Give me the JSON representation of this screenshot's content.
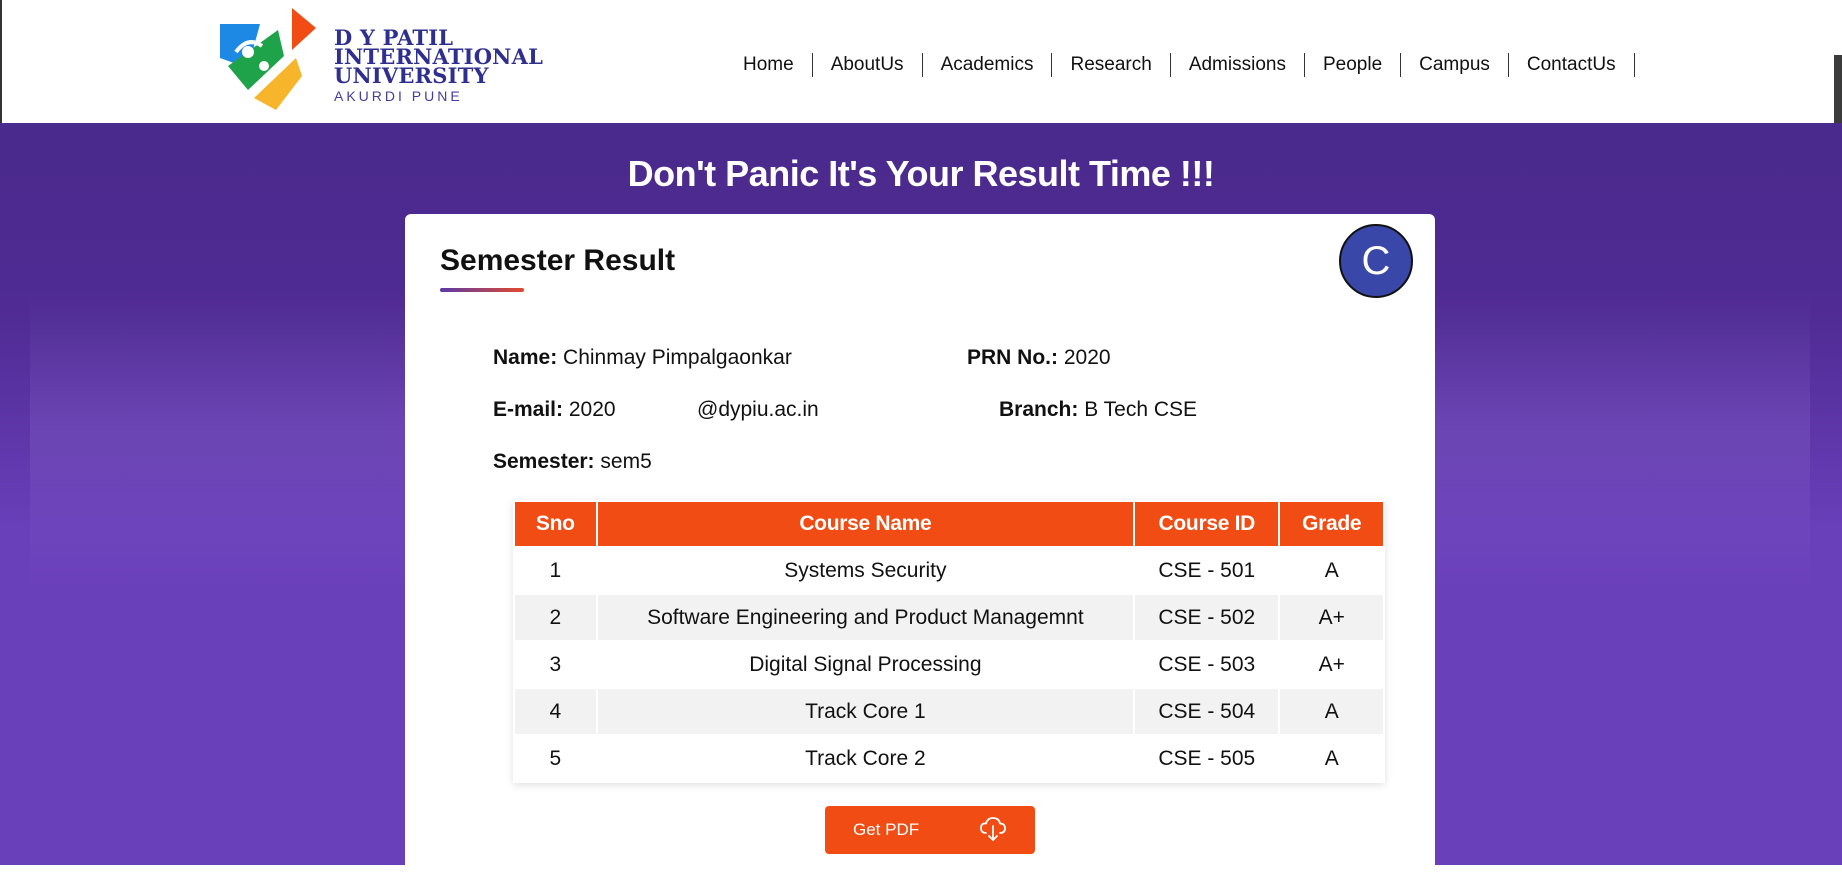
{
  "brand": {
    "line1": "D Y PATIL",
    "line2": "INTERNATIONAL",
    "line3": "UNIVERSITY",
    "sub": "AKURDI PUNE",
    "colors": {
      "navy": "#2e2f8f",
      "orange": "#f04c13",
      "green": "#1fa34a",
      "blue": "#1e88e5",
      "yellow": "#f7b52c"
    }
  },
  "nav": {
    "items": [
      "Home",
      "AboutUs",
      "Academics",
      "Research",
      "Admissions",
      "People",
      "Campus",
      "ContactUs"
    ]
  },
  "hero": {
    "title": "Don't Panic It's Your Result Time !!!"
  },
  "card": {
    "title": "Semester Result",
    "avatar_letter": "C",
    "fields": {
      "name_label": "Name:",
      "name_value": "Chinmay Pimpalgaonkar",
      "prn_label": "PRN No.:",
      "prn_value": "2020",
      "email_label": "E-mail:",
      "email_value_a": "2020",
      "email_value_b": "@dypiu.ac.in",
      "branch_label": "Branch:",
      "branch_value": "B Tech CSE",
      "semester_label": "Semester:",
      "semester_value": "sem5"
    },
    "table": {
      "headers": [
        "Sno",
        "Course Name",
        "Course ID",
        "Grade"
      ],
      "rows": [
        [
          "1",
          "Systems Security",
          "CSE - 501",
          "A"
        ],
        [
          "2",
          "Software Engineering and Product Managemnt",
          "CSE - 502",
          "A+"
        ],
        [
          "3",
          "Digital Signal Processing",
          "CSE - 503",
          "A+"
        ],
        [
          "4",
          "Track Core 1",
          "CSE - 504",
          "A"
        ],
        [
          "5",
          "Track Core 2",
          "CSE - 505",
          "A"
        ]
      ]
    },
    "pdf_button": {
      "label": "Get PDF",
      "icon": "cloud-download-icon"
    }
  }
}
